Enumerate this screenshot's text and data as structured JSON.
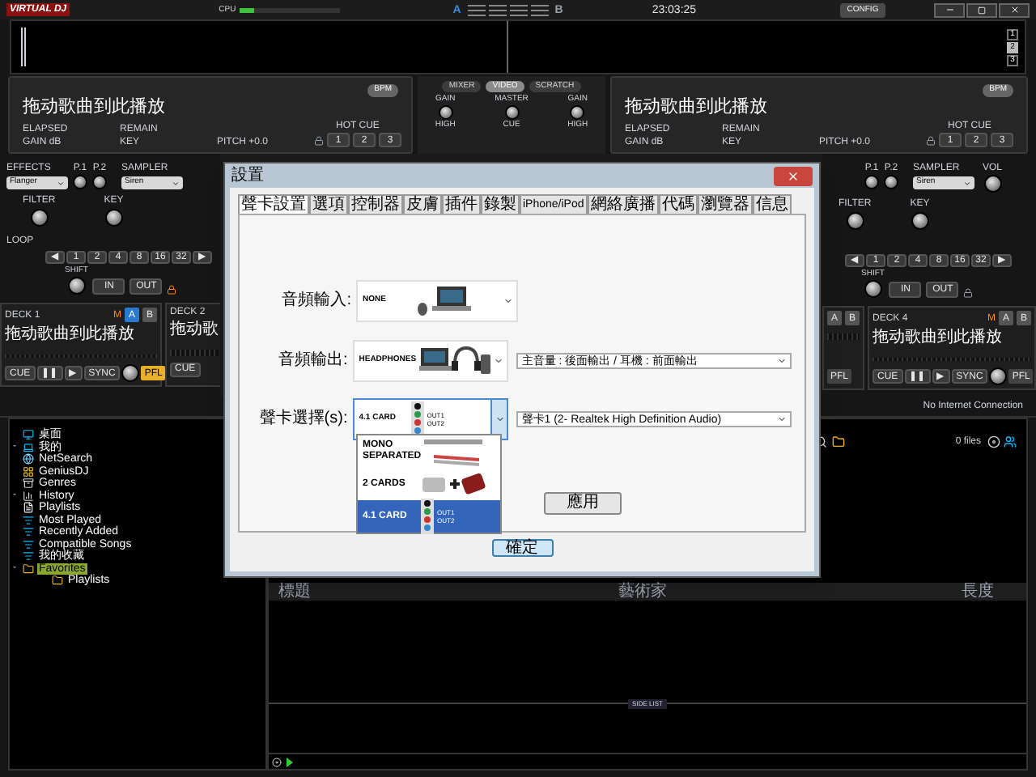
{
  "topbar": {
    "logo": "VIRTUAL DJ",
    "cpu_label": "CPU",
    "cpu_meter": {
      "level": 0.15
    },
    "deck_a": "A",
    "deck_b": "B",
    "clock": "23:03:25",
    "config_button": "CONFIG"
  },
  "waveform": {
    "zoom_buttons": [
      {
        "label": "1",
        "selected": false
      },
      {
        "label": "2",
        "selected": true
      },
      {
        "label": "3",
        "selected": false
      }
    ]
  },
  "decks": [
    {
      "title": "拖动歌曲到此播放",
      "bpm": "BPM",
      "elapsed": "ELAPSED",
      "remain": "REMAIN",
      "gain": "GAIN dB",
      "key": "KEY",
      "pitch": "PITCH +0.0",
      "hot_cue_label": "HOT CUE",
      "hot_cues": [
        "1",
        "2",
        "3"
      ]
    },
    {
      "title": "拖动歌曲到此播放",
      "bpm": "BPM",
      "elapsed": "ELAPSED",
      "remain": "REMAIN",
      "gain": "GAIN dB",
      "key": "KEY",
      "pitch": "PITCH +0.0",
      "hot_cue_label": "HOT CUE",
      "hot_cues": [
        "1",
        "2",
        "3"
      ]
    }
  ],
  "mixer": {
    "tabs": [
      {
        "label": "MIXER",
        "selected": false
      },
      {
        "label": "VIDEO",
        "selected": true
      },
      {
        "label": "SCRATCH",
        "selected": false
      }
    ],
    "knob_labels": [
      "GAIN",
      "MASTER",
      "GAIN"
    ],
    "lower_labels": [
      "HIGH",
      "CUE",
      "HIGH"
    ]
  },
  "left_controls": {
    "effects": "EFFECTS",
    "effect_select": "Flanger",
    "p1": "P.1",
    "p2": "P.2",
    "sampler": "SAMPLER",
    "sampler_select": "Siren",
    "filter": "FILTER",
    "key": "KEY",
    "loop": "LOOP",
    "loop_buttons": [
      "◀",
      "1",
      "2",
      "4",
      "8",
      "16",
      "32",
      "▶"
    ],
    "shift": "SHIFT",
    "in": "IN",
    "out": "OUT"
  },
  "left_players": [
    {
      "label": "DECK 1",
      "mode": "M",
      "ab": [
        {
          "label": "A",
          "selected": true
        },
        {
          "label": "B",
          "selected": false
        }
      ],
      "title": "拖动歌曲到此播放",
      "transport": [
        "CUE",
        "❚❚",
        "▶",
        "SYNC"
      ],
      "pfl": {
        "label": "PFL",
        "on": true
      }
    },
    {
      "label": "DECK 2",
      "title": "拖动歌",
      "transport": [
        "CUE"
      ]
    }
  ],
  "right_controls": {
    "p1": "P.1",
    "p2": "P.2",
    "sampler": "SAMPLER",
    "sampler_select": "Siren",
    "vol": "VOL",
    "filter": "FILTER",
    "key": "KEY",
    "loop_buttons": [
      "◀",
      "1",
      "2",
      "4",
      "8",
      "16",
      "32",
      "▶"
    ],
    "shift": "SHIFT",
    "in": "IN",
    "out": "OUT"
  },
  "right_players": [
    {
      "ab": [
        {
          "label": "A",
          "selected": false
        },
        {
          "label": "B",
          "selected": false
        }
      ],
      "pfl": {
        "label": "PFL",
        "on": false
      }
    },
    {
      "label": "DECK 4",
      "mode": "M",
      "ab": [
        {
          "label": "A",
          "selected": false
        },
        {
          "label": "B",
          "selected": false
        }
      ],
      "title": "拖动歌曲到此播放",
      "transport": [
        "CUE",
        "❚❚",
        "▶",
        "SYNC"
      ],
      "pfl": {
        "label": "PFL",
        "on": false
      }
    }
  ],
  "status": "No Internet Connection",
  "browser": {
    "tree": [
      {
        "label": "桌面",
        "kind": "desktop"
      },
      {
        "label": "我的",
        "kind": "computer",
        "toggle": "-"
      },
      {
        "label": "NetSearch",
        "kind": "net"
      },
      {
        "label": "GeniusDJ",
        "kind": "genius"
      },
      {
        "label": "Genres",
        "kind": "genres"
      },
      {
        "label": "History",
        "kind": "history",
        "toggle": "-"
      },
      {
        "label": "Playlists",
        "kind": "file"
      },
      {
        "label": "Most Played",
        "kind": "filter"
      },
      {
        "label": "Recently Added",
        "kind": "filter"
      },
      {
        "label": "Compatible Songs",
        "kind": "filter"
      },
      {
        "label": "我的收藏",
        "kind": "filter"
      },
      {
        "label": "Favorites",
        "kind": "folder",
        "toggle": "-",
        "selected": true,
        "children": [
          {
            "label": "Playlists",
            "kind": "folder",
            "selected": false
          }
        ]
      }
    ],
    "file_count": "0 files",
    "columns": [
      "標題",
      "藝術家",
      "長度"
    ],
    "side_list": "SIDE LIST"
  },
  "dialog": {
    "title": "設置",
    "tabs": [
      {
        "label": "聲卡設置",
        "selected": true
      },
      {
        "label": "選項",
        "selected": false
      },
      {
        "label": "控制器",
        "selected": false
      },
      {
        "label": "皮膚",
        "selected": false
      },
      {
        "label": "插件",
        "selected": false
      },
      {
        "label": "錄製",
        "selected": false
      },
      {
        "label": "iPhone/iPod",
        "selected": false
      },
      {
        "label": "網絡廣播",
        "selected": false
      },
      {
        "label": "代碼",
        "selected": false
      },
      {
        "label": "瀏覽器",
        "selected": false
      },
      {
        "label": "信息",
        "selected": false
      }
    ],
    "rows": [
      {
        "label": "音頻輸入:",
        "device": {
          "name": "NONE",
          "kind": "laptop"
        },
        "open": false
      },
      {
        "label": "音頻輸出:",
        "device": {
          "name": "HEADPHONES",
          "kind": "headphones"
        },
        "option": "主音量 : 後面輸出 / 耳機 : 前面輸出",
        "open": false
      },
      {
        "label": "聲卡選擇(s):",
        "device": {
          "name": "4.1 CARD",
          "kind": "card",
          "jacks": [
            "OUT1",
            "OUT2"
          ]
        },
        "option": "聲卡1 (2- Realtek High Definition Audio)",
        "open": true
      }
    ],
    "list": [
      {
        "name": "MONO SEPARATED",
        "kind": "mono",
        "selected": false
      },
      {
        "name": "2 CARDS",
        "kind": "twocards",
        "selected": false
      },
      {
        "name": "4.1 CARD",
        "kind": "card",
        "jacks": [
          "OUT1",
          "OUT2"
        ],
        "selected": true
      }
    ],
    "apply": "應用",
    "ok": "確定"
  }
}
